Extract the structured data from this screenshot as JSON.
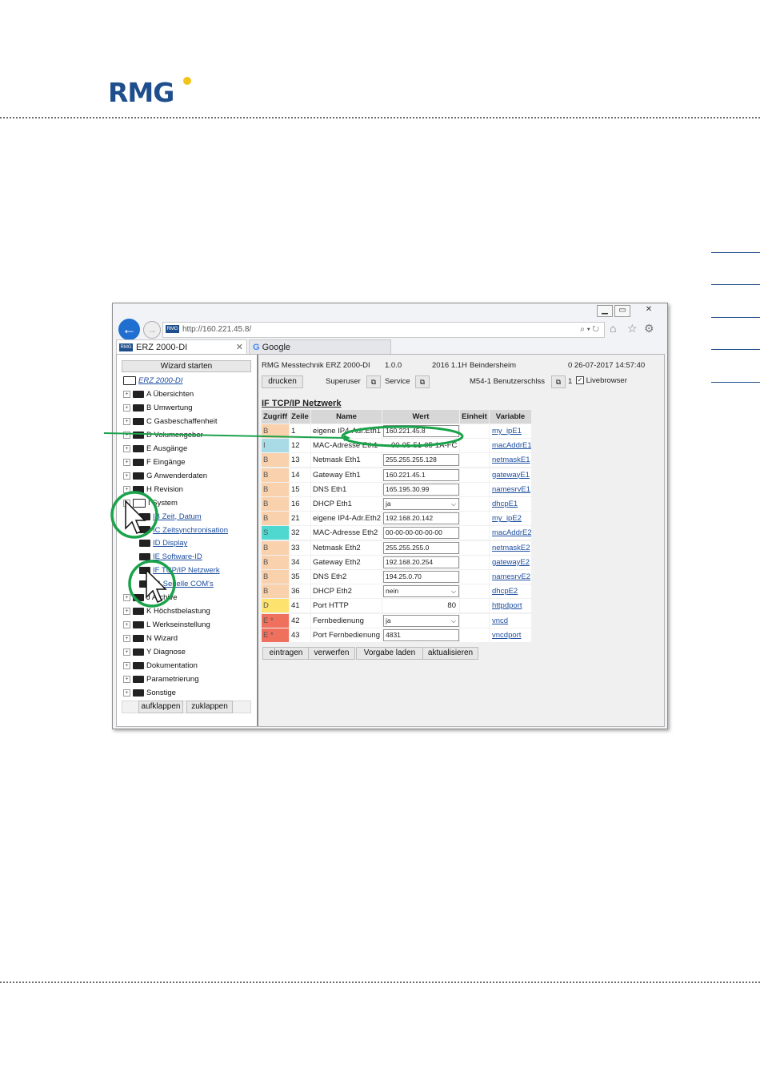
{
  "logo": {
    "text": "RMG",
    "accent_color": "#f2c318",
    "brand_color": "#1f4e8c"
  },
  "browser": {
    "window_controls": [
      "▁",
      "▭",
      "✕"
    ],
    "address": "http://160.221.45.8/",
    "favicon_text": "RMG",
    "tabs": [
      {
        "label": "ERZ 2000-DI",
        "close": "✕"
      },
      {
        "label": "Google"
      }
    ]
  },
  "tree": {
    "wizard_button": "Wizard starten",
    "root": "ERZ 2000-DI",
    "items": [
      {
        "label": "A Übersichten",
        "type": "folder"
      },
      {
        "label": "B Umwertung",
        "type": "folder"
      },
      {
        "label": "C Gasbeschaffenheit",
        "type": "folder"
      },
      {
        "label": "D Volumengeber",
        "type": "folder"
      },
      {
        "label": "E Ausgänge",
        "type": "folder"
      },
      {
        "label": "F Eingänge",
        "type": "folder"
      },
      {
        "label": "G Anwenderdaten",
        "type": "folder"
      },
      {
        "label": "H Revision",
        "type": "folder"
      },
      {
        "label": "I System",
        "type": "open"
      },
      {
        "label": "IB Zeit, Datum",
        "type": "child"
      },
      {
        "label": "IC Zeitsynchronisation",
        "type": "child"
      },
      {
        "label": "ID Display",
        "type": "child"
      },
      {
        "label": "IE Software-ID",
        "type": "child"
      },
      {
        "label": "IF TCP/IP Netzwerk",
        "type": "child"
      },
      {
        "label": "IG Serielle COM's",
        "type": "child"
      },
      {
        "label": "J Archive",
        "type": "folder"
      },
      {
        "label": "K Höchstbelastung",
        "type": "folder"
      },
      {
        "label": "L Werkseinstellung",
        "type": "folder"
      },
      {
        "label": "N Wizard",
        "type": "folder"
      },
      {
        "label": "Y Diagnose",
        "type": "folder"
      },
      {
        "label": "Dokumentation",
        "type": "folder"
      },
      {
        "label": "Parametrierung",
        "type": "folder"
      },
      {
        "label": "Sonstige",
        "type": "folder"
      }
    ],
    "expand_button": "aufklappen",
    "collapse_button": "zuklappen"
  },
  "info_bar": {
    "device": "RMG Messtechnik ERZ 2000-DI",
    "version": "1.0.0",
    "build": "2016 1.1H",
    "location": "Beindersheim",
    "datetime": "0 26-07-2017 14:57:40",
    "print_button": "drucken",
    "user": "Superuser",
    "mode": "Service",
    "lock": "M54-1 Benutzerschlss",
    "lock_value": "1",
    "livebrowser": "Livebrowser"
  },
  "page_title": "IF TCP/IP Netzwerk",
  "table": {
    "headers": [
      "Zugriff",
      "Zeile",
      "Name",
      "Wert",
      "Einheit",
      "Variable"
    ],
    "rows": [
      {
        "access": "B",
        "line": "1",
        "name": "eigene IP4-Adr.Eth1",
        "value": "160.221.45.8",
        "kind": "input",
        "variable": "my_ipE1",
        "color": "#f9d1ad"
      },
      {
        "access": "I",
        "line": "12",
        "name": "MAC-Adresse Eth1",
        "value": "00-05-51-05-1A-FC",
        "kind": "text",
        "variable": "macAddrE1",
        "color": "#a9dbe6"
      },
      {
        "access": "B",
        "line": "13",
        "name": "Netmask Eth1",
        "value": "255.255.255.128",
        "kind": "input",
        "variable": "netmaskE1",
        "color": "#f9d1ad"
      },
      {
        "access": "B",
        "line": "14",
        "name": "Gateway Eth1",
        "value": "160.221.45.1",
        "kind": "input",
        "variable": "gatewayE1",
        "color": "#f9d1ad"
      },
      {
        "access": "B",
        "line": "15",
        "name": "DNS Eth1",
        "value": "165.195.30.99",
        "kind": "input",
        "variable": "namesrvE1",
        "color": "#f9d1ad"
      },
      {
        "access": "B",
        "line": "16",
        "name": "DHCP Eth1",
        "value": "ja",
        "kind": "select",
        "variable": "dhcpE1",
        "color": "#f9d1ad"
      },
      {
        "access": "B",
        "line": "21",
        "name": "eigene IP4-Adr.Eth2",
        "value": "192.168.20.142",
        "kind": "input",
        "variable": "my_ipE2",
        "color": "#f9d1ad"
      },
      {
        "access": "S",
        "line": "32",
        "name": "MAC-Adresse Eth2",
        "value": "00-00-00-00-00-00",
        "kind": "input",
        "variable": "macAddrE2",
        "color": "#4fd8cf"
      },
      {
        "access": "B",
        "line": "33",
        "name": "Netmask Eth2",
        "value": "255.255.255.0",
        "kind": "input",
        "variable": "netmaskE2",
        "color": "#f9d1ad"
      },
      {
        "access": "B",
        "line": "34",
        "name": "Gateway Eth2",
        "value": "192.168.20.254",
        "kind": "input",
        "variable": "gatewayE2",
        "color": "#f9d1ad"
      },
      {
        "access": "B",
        "line": "35",
        "name": "DNS Eth2",
        "value": "194.25.0.70",
        "kind": "input",
        "variable": "namesrvE2",
        "color": "#f9d1ad"
      },
      {
        "access": "B",
        "line": "36",
        "name": "DHCP Eth2",
        "value": "nein",
        "kind": "select",
        "variable": "dhcpE2",
        "color": "#f9d1ad"
      },
      {
        "access": "D",
        "line": "41",
        "name": "Port HTTP",
        "value": "80",
        "kind": "number",
        "variable": "httpdport",
        "color": "#fde36e"
      },
      {
        "access": "E *",
        "line": "42",
        "name": "Fernbedienung",
        "value": "ja",
        "kind": "select",
        "variable": "vncd",
        "color": "#f0705e"
      },
      {
        "access": "E *",
        "line": "43",
        "name": "Port Fernbedienung",
        "value": "4831",
        "kind": "input",
        "variable": "vncdport",
        "color": "#f0705e"
      }
    ]
  },
  "actions": [
    "eintragen",
    "verwerfen",
    "Vorgabe laden",
    "aktualisieren"
  ],
  "annotation_color": "#1aa34a"
}
